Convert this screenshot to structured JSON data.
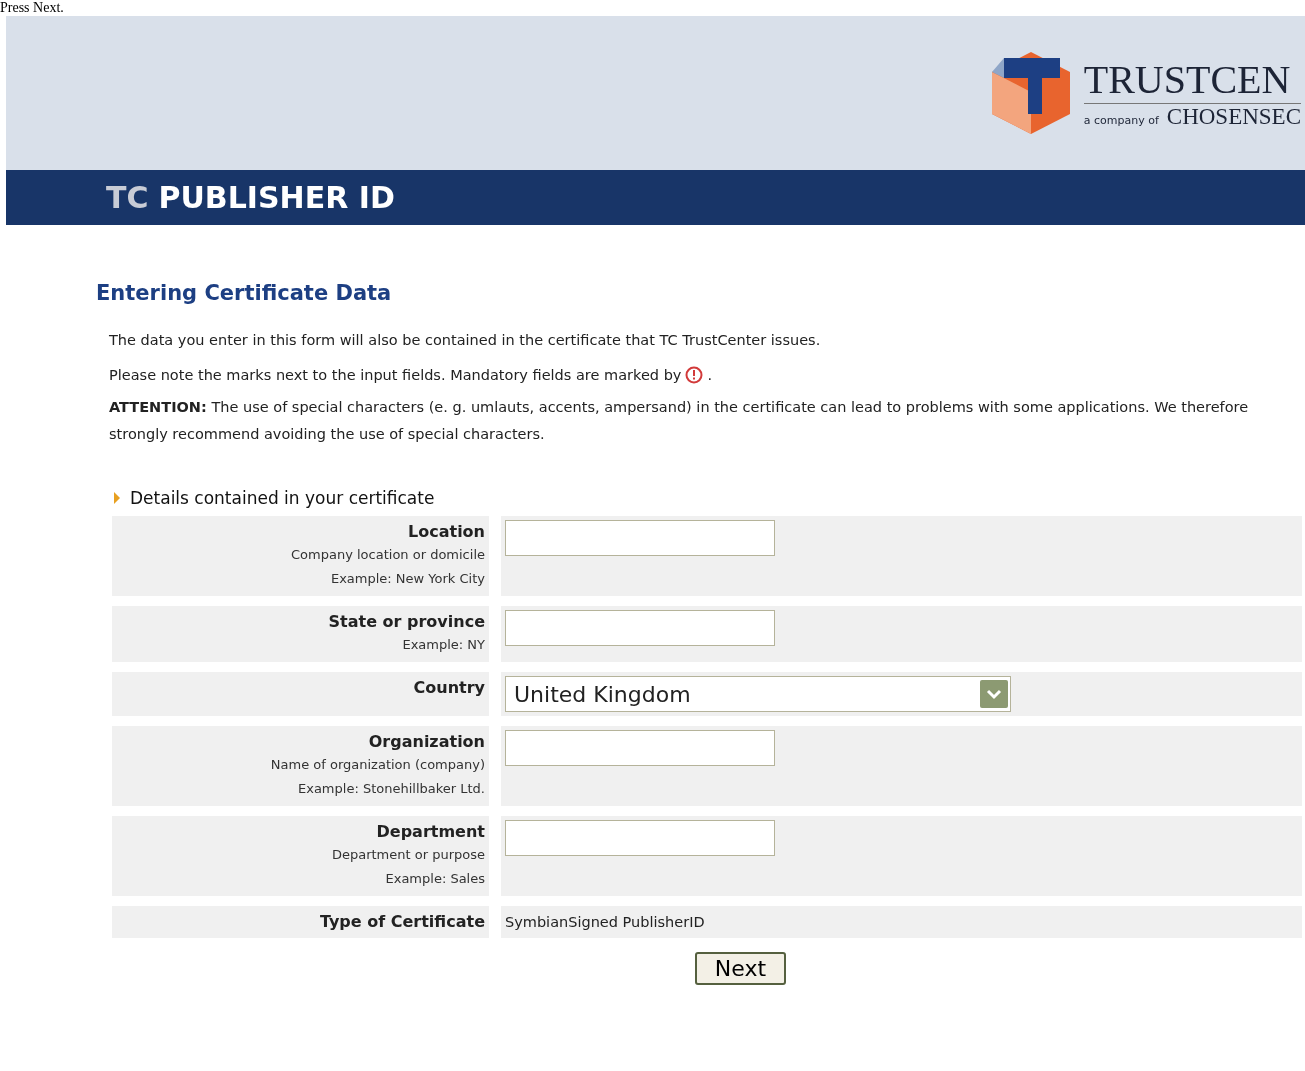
{
  "caption": "Press Next.",
  "header": {
    "logo_title": "TRUSTCEN",
    "logo_tagline": "a company of",
    "logo_parent": "CHOSENSEC",
    "banner_prefix": "TC",
    "banner_title": "PUBLISHER ID"
  },
  "page_title": "Entering Certificate Data",
  "intro": "The data you enter in this form will also be contained in the certificate that TC TrustCenter issues.",
  "mandatory_note": {
    "text": "Please note the marks next to the input fields. Mandatory fields are marked by",
    "end": "."
  },
  "attention": "**ATTENTION:** The use of special characters (e. g. umlauts, accents, ampersand) in the certificate can lead to problems with some applications. We therefore strongly recommend avoiding the use of special characters.",
  "section_title": "Details contained in your certificate",
  "fields": [
    {
      "kind": "text",
      "label": "Location",
      "hints": [
        "Company location or domicile",
        "Example: New York City"
      ]
    },
    {
      "kind": "text",
      "label": "State or province",
      "hints": [
        "Example: NY"
      ]
    },
    {
      "kind": "select",
      "label": "Country",
      "value": "United Kingdom"
    },
    {
      "kind": "text",
      "label": "Organization",
      "hints": [
        "Name of organization (company)",
        "Example: Stonehillbaker Ltd."
      ]
    },
    {
      "kind": "text",
      "label": "Department",
      "hints": [
        "Department or purpose",
        "Example: Sales"
      ]
    },
    {
      "kind": "static",
      "label": "Type of Certificate",
      "value": "SymbianSigned PublisherID"
    }
  ],
  "next_button": "Next"
}
